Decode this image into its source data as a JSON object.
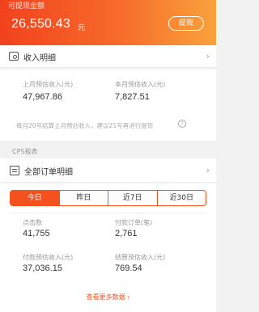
{
  "header": {
    "withdrawable_label": "可提现金额",
    "amount": "26,550.43",
    "unit": "元",
    "withdraw_button": "提现"
  },
  "income": {
    "title": "收入明细",
    "last_month_label": "上月预估收入(元)",
    "last_month_value": "47,967.86",
    "this_month_label": "本月预估收入(元)",
    "this_month_value": "7,827.51",
    "note": "每月20号结算上月预估收入，建议21号再进行提现"
  },
  "cps": {
    "section_label": "CPS报表",
    "orders_title": "全部订单明细",
    "tabs": [
      "今日",
      "昨日",
      "近7日",
      "近30日"
    ],
    "active_tab": "今日",
    "stats": {
      "clicks_label": "点击数",
      "clicks_value": "41,755",
      "paid_orders_label": "付款订单(笔)",
      "paid_orders_value": "2,761",
      "paid_estimate_label": "付款预估收入(元)",
      "paid_estimate_value": "37,036.15",
      "settled_estimate_label": "结算预估收入(元)",
      "settled_estimate_value": "769.54"
    },
    "more_link": "查看更多数据"
  },
  "colors": {
    "accent": "#f4511e",
    "header_gradient_start": "#f2421e",
    "header_gradient_end": "#f9a23c"
  }
}
